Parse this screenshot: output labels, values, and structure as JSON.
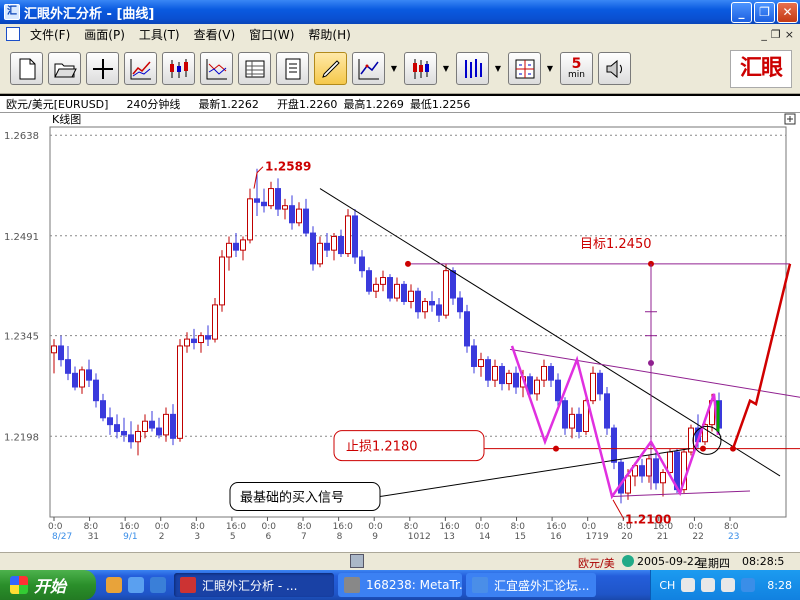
{
  "window": {
    "title": "汇眼外汇分析 - [曲线]",
    "icon_label": "汇"
  },
  "menu": {
    "items": [
      "文件(F)",
      "画面(P)",
      "工具(T)",
      "查看(V)",
      "窗口(W)",
      "帮助(H)"
    ],
    "mdi_controls": [
      "_",
      "❐",
      "×"
    ]
  },
  "toolbar": {
    "buttons": [
      "new-icon",
      "open-icon",
      "crosshair-icon",
      "line-chart-icon",
      "candlestick-icon",
      "multi-line-icon",
      "table-icon",
      "document-icon",
      "pen-icon",
      "axes-icon",
      "candle-red-icon",
      "bar-chart-icon",
      "grid-icon",
      "period-icon",
      "speaker-icon"
    ],
    "period_num": "5",
    "period_unit": "min",
    "brand": "汇眼"
  },
  "info": {
    "pair": "欧元/美元[EURUSD]",
    "interval": "240分钟线",
    "latest": "最新1.2262",
    "open": "开盘1.2260",
    "high": "最高1.2269",
    "low": "最低1.2256"
  },
  "chart_data": {
    "type": "candlestick",
    "title": "K线图",
    "ylim": [
      1.208,
      1.265
    ],
    "y_ticks": [
      "1.2638",
      "1.2491",
      "1.2345",
      "1.2198"
    ],
    "x_ticks": [
      "0:0",
      "8:0",
      "16:0",
      "0:0",
      "8:0",
      "16:0",
      "0:0",
      "8:0",
      "16:0",
      "0:0",
      "8:0",
      "16:0",
      "0:0",
      "8:0",
      "16:0",
      "0:0",
      "8:0",
      "16:0",
      "0:0",
      "8:0"
    ],
    "date_labels": [
      "8/27",
      "31",
      "9/1",
      "2",
      "3",
      "5",
      "6",
      "7",
      "8",
      "9",
      "1012",
      "13",
      "14",
      "15",
      "16",
      "1719",
      "20",
      "21",
      "22",
      "23"
    ],
    "annotations": {
      "high": "1.2589",
      "target": "目标1.2450",
      "stoploss": "止损1.2180",
      "low": "1.2100",
      "signal": "最基础的买入信号"
    },
    "candles": [
      [
        1.232,
        1.234,
        1.229,
        1.233
      ],
      [
        1.233,
        1.2345,
        1.23,
        1.231
      ],
      [
        1.231,
        1.233,
        1.228,
        1.229
      ],
      [
        1.229,
        1.23,
        1.2265,
        1.227
      ],
      [
        1.227,
        1.23,
        1.226,
        1.2295
      ],
      [
        1.2295,
        1.231,
        1.227,
        1.228
      ],
      [
        1.228,
        1.229,
        1.224,
        1.225
      ],
      [
        1.225,
        1.226,
        1.222,
        1.2225
      ],
      [
        1.2225,
        1.224,
        1.22,
        1.2215
      ],
      [
        1.2215,
        1.223,
        1.2195,
        1.2205
      ],
      [
        1.2205,
        1.2225,
        1.219,
        1.22
      ],
      [
        1.22,
        1.222,
        1.218,
        1.219
      ],
      [
        1.219,
        1.2215,
        1.217,
        1.2205
      ],
      [
        1.2205,
        1.223,
        1.2195,
        1.222
      ],
      [
        1.222,
        1.2235,
        1.2205,
        1.221
      ],
      [
        1.221,
        1.2225,
        1.2195,
        1.22
      ],
      [
        1.22,
        1.224,
        1.219,
        1.223
      ],
      [
        1.223,
        1.2245,
        1.2185,
        1.2195
      ],
      [
        1.2195,
        1.234,
        1.219,
        1.233
      ],
      [
        1.233,
        1.235,
        1.232,
        1.234
      ],
      [
        1.234,
        1.2355,
        1.2325,
        1.2335
      ],
      [
        1.2335,
        1.235,
        1.232,
        1.2345
      ],
      [
        1.2345,
        1.236,
        1.233,
        1.234
      ],
      [
        1.234,
        1.24,
        1.2335,
        1.239
      ],
      [
        1.239,
        1.247,
        1.238,
        1.246
      ],
      [
        1.246,
        1.249,
        1.244,
        1.248
      ],
      [
        1.248,
        1.2495,
        1.246,
        1.247
      ],
      [
        1.247,
        1.249,
        1.2455,
        1.2485
      ],
      [
        1.2485,
        1.256,
        1.248,
        1.2545
      ],
      [
        1.2545,
        1.2589,
        1.252,
        1.254
      ],
      [
        1.254,
        1.256,
        1.2525,
        1.2535
      ],
      [
        1.2535,
        1.257,
        1.253,
        1.256
      ],
      [
        1.256,
        1.2575,
        1.252,
        1.253
      ],
      [
        1.253,
        1.2545,
        1.2515,
        1.2535
      ],
      [
        1.2535,
        1.255,
        1.25,
        1.251
      ],
      [
        1.251,
        1.254,
        1.2505,
        1.253
      ],
      [
        1.253,
        1.2545,
        1.249,
        1.2495
      ],
      [
        1.2495,
        1.2505,
        1.244,
        1.245
      ],
      [
        1.245,
        1.249,
        1.2445,
        1.248
      ],
      [
        1.248,
        1.2495,
        1.246,
        1.247
      ],
      [
        1.247,
        1.2495,
        1.2455,
        1.249
      ],
      [
        1.249,
        1.25,
        1.246,
        1.2465
      ],
      [
        1.2465,
        1.253,
        1.246,
        1.252
      ],
      [
        1.252,
        1.253,
        1.245,
        1.246
      ],
      [
        1.246,
        1.247,
        1.243,
        1.244
      ],
      [
        1.244,
        1.2445,
        1.2405,
        1.241
      ],
      [
        1.241,
        1.243,
        1.24,
        1.242
      ],
      [
        1.242,
        1.244,
        1.241,
        1.243
      ],
      [
        1.243,
        1.2435,
        1.2395,
        1.24
      ],
      [
        1.24,
        1.243,
        1.2395,
        1.242
      ],
      [
        1.242,
        1.2425,
        1.239,
        1.2395
      ],
      [
        1.2395,
        1.242,
        1.2385,
        1.241
      ],
      [
        1.241,
        1.2415,
        1.237,
        1.238
      ],
      [
        1.238,
        1.24,
        1.237,
        1.2395
      ],
      [
        1.2395,
        1.241,
        1.238,
        1.239
      ],
      [
        1.239,
        1.24,
        1.2365,
        1.2375
      ],
      [
        1.2375,
        1.245,
        1.237,
        1.244
      ],
      [
        1.244,
        1.2445,
        1.239,
        1.24
      ],
      [
        1.24,
        1.241,
        1.237,
        1.238
      ],
      [
        1.238,
        1.239,
        1.232,
        1.233
      ],
      [
        1.233,
        1.234,
        1.229,
        1.23
      ],
      [
        1.23,
        1.232,
        1.2285,
        1.231
      ],
      [
        1.231,
        1.2315,
        1.227,
        1.228
      ],
      [
        1.228,
        1.231,
        1.227,
        1.23
      ],
      [
        1.23,
        1.2305,
        1.2265,
        1.2275
      ],
      [
        1.2275,
        1.2295,
        1.2265,
        1.229
      ],
      [
        1.229,
        1.23,
        1.226,
        1.227
      ],
      [
        1.227,
        1.2295,
        1.2255,
        1.2285
      ],
      [
        1.2285,
        1.229,
        1.225,
        1.226
      ],
      [
        1.226,
        1.2285,
        1.225,
        1.228
      ],
      [
        1.228,
        1.231,
        1.227,
        1.23
      ],
      [
        1.23,
        1.2305,
        1.227,
        1.228
      ],
      [
        1.228,
        1.229,
        1.224,
        1.225
      ],
      [
        1.225,
        1.2255,
        1.22,
        1.221
      ],
      [
        1.221,
        1.224,
        1.2195,
        1.223
      ],
      [
        1.223,
        1.224,
        1.2195,
        1.2205
      ],
      [
        1.2205,
        1.226,
        1.22,
        1.225
      ],
      [
        1.225,
        1.23,
        1.2245,
        1.229
      ],
      [
        1.229,
        1.2295,
        1.225,
        1.226
      ],
      [
        1.226,
        1.227,
        1.22,
        1.221
      ],
      [
        1.221,
        1.2215,
        1.215,
        1.216
      ],
      [
        1.216,
        1.2165,
        1.21,
        1.2115
      ],
      [
        1.2115,
        1.215,
        1.2105,
        1.214
      ],
      [
        1.214,
        1.216,
        1.2125,
        1.2155
      ],
      [
        1.2155,
        1.2165,
        1.213,
        1.214
      ],
      [
        1.214,
        1.217,
        1.213,
        1.2165
      ],
      [
        1.2165,
        1.2175,
        1.212,
        1.213
      ],
      [
        1.213,
        1.215,
        1.211,
        1.2145
      ],
      [
        1.2145,
        1.218,
        1.214,
        1.2175
      ],
      [
        1.2175,
        1.218,
        1.2115,
        1.212
      ],
      [
        1.212,
        1.218,
        1.2115,
        1.2175
      ],
      [
        1.2175,
        1.2215,
        1.217,
        1.221
      ],
      [
        1.221,
        1.223,
        1.218,
        1.219
      ],
      [
        1.219,
        1.2225,
        1.2185,
        1.2215
      ],
      [
        1.2215,
        1.226,
        1.2205,
        1.225
      ],
      [
        1.225,
        1.2262,
        1.22,
        1.221
      ]
    ],
    "colors": {
      "up": "#c00000",
      "down": "#3a3adc",
      "magenta": "#e030e0",
      "purple": "#902090",
      "red_line": "#d00000",
      "grid": "#888888"
    }
  },
  "status": {
    "pair": "欧元/美",
    "date": "2005-09-22",
    "weekday": "星期四",
    "time": "08:28:5"
  },
  "taskbar": {
    "start": "开始",
    "tasks": [
      "汇眼外汇分析 - ...",
      "168238: MetaTr...",
      "汇宜盛外汇论坛..."
    ],
    "lang": "CH",
    "clock": "8:28"
  }
}
